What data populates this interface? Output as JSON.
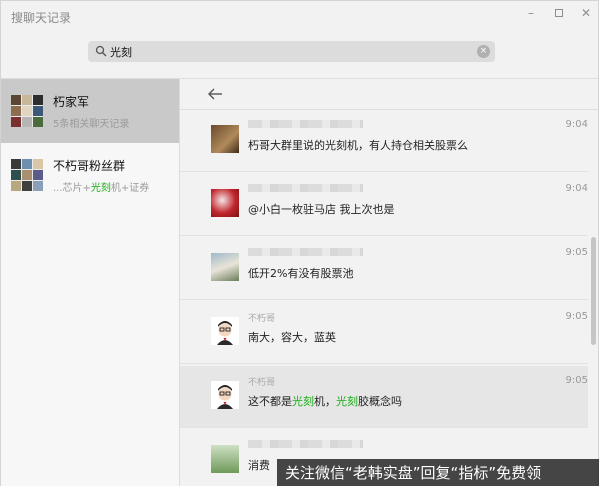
{
  "window": {
    "title": "搜聊天记录",
    "controls": {
      "minimize": "–",
      "close": "✕"
    }
  },
  "search": {
    "value": "光刻",
    "clear": "×"
  },
  "sidebar": {
    "items": [
      {
        "name": "朽家军",
        "sub_prefix": "5条相关聊天记录",
        "sub_highlight": "",
        "sub_suffix": ""
      },
      {
        "name": "不朽哥粉丝群",
        "sub_prefix": "...芯片+",
        "sub_highlight": "光刻",
        "sub_suffix": "机+证券"
      }
    ]
  },
  "messages": [
    {
      "sender": "",
      "time": "9:04",
      "parts": [
        {
          "t": "朽哥大群里说的光刻机，有人持仓相关股票么",
          "h": false
        }
      ]
    },
    {
      "sender": "",
      "time": "9:04",
      "parts": [
        {
          "t": "@小白一枚驻马店 我上次也是",
          "h": false
        }
      ]
    },
    {
      "sender": "",
      "time": "9:05",
      "parts": [
        {
          "t": "低开2%有没有股票池",
          "h": false
        }
      ]
    },
    {
      "sender": "不朽哥",
      "time": "9:05",
      "parts": [
        {
          "t": "南大，容大，蓝英",
          "h": false
        }
      ]
    },
    {
      "sender": "不朽哥",
      "time": "9:05",
      "parts": [
        {
          "t": "这不都是",
          "h": false
        },
        {
          "t": "光刻",
          "h": true
        },
        {
          "t": "机，",
          "h": false
        },
        {
          "t": "光刻",
          "h": true
        },
        {
          "t": "胶概念吗",
          "h": false
        }
      ]
    },
    {
      "sender": "",
      "time": "",
      "parts": [
        {
          "t": "消费",
          "h": false
        }
      ]
    }
  ],
  "watermark": "关注微信“老韩实盘”回复“指标”免费领",
  "colors": {
    "highlight": "#1aad19",
    "active_sidebar": "#c9c9c9",
    "active_message": "#e6e6e6"
  }
}
